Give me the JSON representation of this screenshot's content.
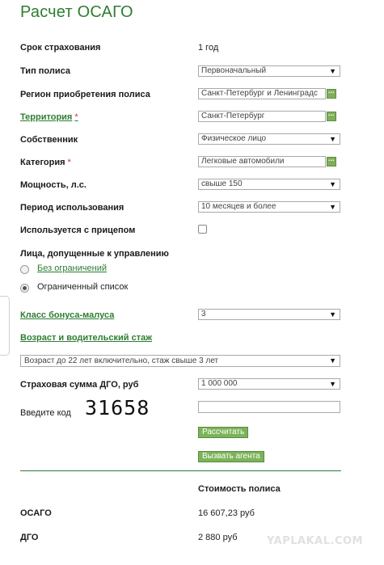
{
  "page": {
    "title": "Расчет ОСАГО"
  },
  "form": {
    "term": {
      "label": "Срок страхования",
      "value": "1 год"
    },
    "policy_type": {
      "label": "Тип полиса",
      "value": "Первоначальный"
    },
    "region": {
      "label": "Регион приобретения полиса",
      "value": "Санкт-Петербург и Ленинградс"
    },
    "territory": {
      "label": "Территория",
      "required_mark": "*",
      "value": "Санкт-Петербург"
    },
    "owner": {
      "label": "Собственник",
      "value": "Физическое лицо"
    },
    "category": {
      "label": "Категория",
      "required_mark": "*",
      "value": "Легковые автомобили"
    },
    "power": {
      "label": "Мощность, л.с.",
      "value": "свыше 150"
    },
    "period": {
      "label": "Период использования",
      "value": "10 месяцев и более"
    },
    "trailer": {
      "label": "Используется с прицепом",
      "checked": false
    },
    "drivers": {
      "label": "Лица, допущенные к управлению",
      "options": [
        {
          "label": "Без ограничений",
          "selected": false
        },
        {
          "label": "Ограниченный список",
          "selected": true
        }
      ]
    },
    "bonus_malus": {
      "label": "Класс бонуса-малуса",
      "value": "3"
    },
    "age_experience": {
      "label": "Возраст и водительский стаж",
      "value": "Возраст до 22 лет включительно, стаж свыше 3 лет"
    },
    "dgo_sum": {
      "label": "Страховая сумма ДГО, руб",
      "value": "1 000 000"
    },
    "captcha": {
      "label": "Введите код",
      "code": "31658",
      "input_value": ""
    },
    "calculate_label": "Рассчитать",
    "call_agent_label": "Вызвать агента"
  },
  "results": {
    "header": "Стоимость полиса",
    "rows": [
      {
        "label": "ОСАГО",
        "value": "16 607,23 руб"
      },
      {
        "label": "ДГО",
        "value": "2 880 руб"
      }
    ]
  },
  "watermark": "YAPLAKAL.COM",
  "colors": {
    "accent": "#2e7d32",
    "button": "#7cb35a"
  }
}
